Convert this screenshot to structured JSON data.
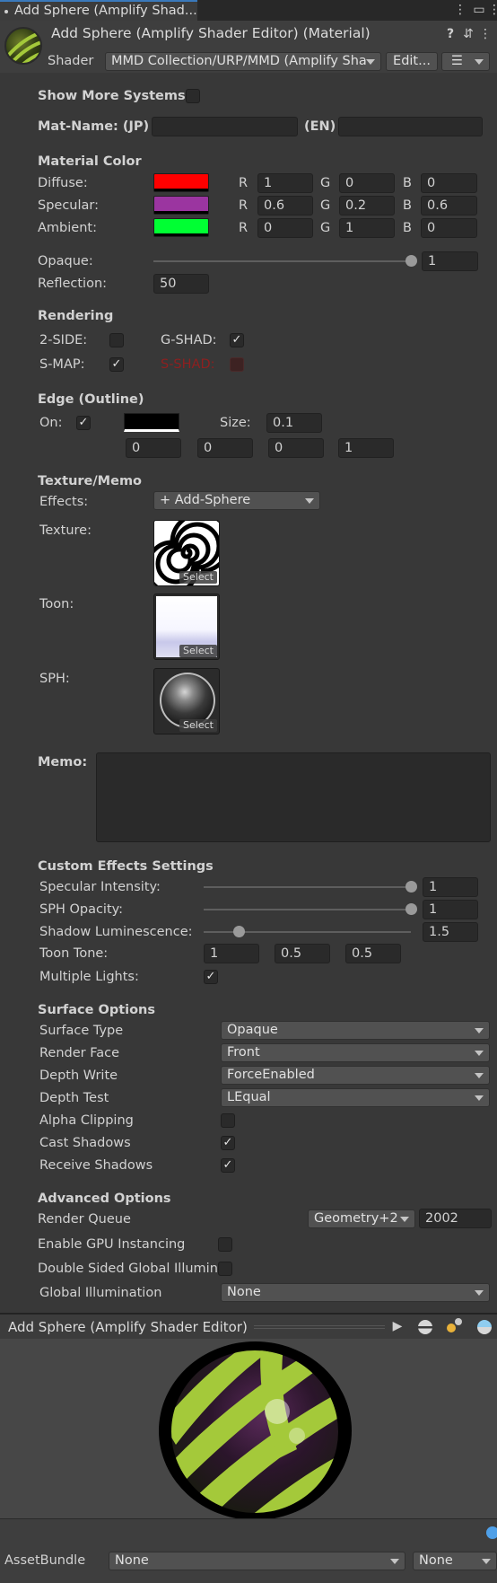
{
  "window": {
    "tab_title": "Add Sphere (Amplify Shad...",
    "header_title": "Add Sphere (Amplify Shader Editor) (Material)",
    "shader_label": "Shader",
    "shader_value": "MMD Collection/URP/MMD (Amplify Sha",
    "edit_button": "Edit..."
  },
  "mmd": {
    "show_more_systems": "Show More Systems:",
    "mat_name_jp": "Mat-Name: (JP)",
    "mat_name_en": "(EN)",
    "material_color_header": "Material Color",
    "diffuse_label": "Diffuse:",
    "specular_label": "Specular:",
    "ambient_label": "Ambient:",
    "r_label": "R",
    "g_label": "G",
    "b_label": "B",
    "diffuse": {
      "r": "1",
      "g": "0",
      "b": "0",
      "color": "#ff0000"
    },
    "specular": {
      "r": "0.6",
      "g": "0.2",
      "b": "0.6",
      "color": "#9b35a0"
    },
    "ambient": {
      "r": "0",
      "g": "1",
      "b": "0",
      "color": "#00ff33"
    },
    "opaque_label": "Opaque:",
    "opaque_value": "1",
    "opaque_level": 1,
    "reflection_label": "Reflection:",
    "reflection_value": "50",
    "rendering_header": "Rendering",
    "two_side_label": "2-SIDE:",
    "g_shad_label": "G-SHAD:",
    "s_map_label": "S-MAP:",
    "s_shad_label": "S-SHAD:",
    "edge_header": "Edge (Outline)",
    "edge_on_label": "On:",
    "edge_size_label": "Size:",
    "edge_size_value": "0.1",
    "edge_rgba": [
      "0",
      "0",
      "0",
      "1"
    ],
    "texture_header": "Texture/Memo",
    "effects_label": "Effects:",
    "effects_value": "+ Add-Sphere",
    "texture_label": "Texture:",
    "toon_label": "Toon:",
    "sph_label": "SPH:",
    "select_label": "Select",
    "memo_label": "Memo:"
  },
  "custom_effects": {
    "header": "Custom Effects Settings",
    "specular_intensity_label": "Specular Intensity:",
    "specular_intensity_value": "1",
    "specular_intensity_level": 1,
    "sph_opacity_label": "SPH Opacity:",
    "sph_opacity_value": "1",
    "sph_opacity_level": 1,
    "shadow_lum_label": "Shadow Luminescence:",
    "shadow_lum_value": "1.5",
    "shadow_lum_level": 0.17,
    "toon_tone_label": "Toon Tone:",
    "toon_tone_values": [
      "1",
      "0.5",
      "0.5"
    ],
    "multiple_lights_label": "Multiple Lights:"
  },
  "surface": {
    "header": "Surface Options",
    "surface_type_label": "Surface Type",
    "surface_type_value": "Opaque",
    "render_face_label": "Render Face",
    "render_face_value": "Front",
    "depth_write_label": "Depth Write",
    "depth_write_value": "ForceEnabled",
    "depth_test_label": "Depth Test",
    "depth_test_value": "LEqual",
    "alpha_clipping_label": "Alpha Clipping",
    "cast_shadows_label": "Cast Shadows",
    "receive_shadows_label": "Receive Shadows"
  },
  "advanced": {
    "header": "Advanced Options",
    "render_queue_label": "Render Queue",
    "render_queue_dropdown": "Geometry+2",
    "render_queue_value": "2002",
    "gpu_instancing_label": "Enable GPU Instancing",
    "double_sided_gi_label": "Double Sided Global Illumin",
    "global_illumination_label": "Global Illumination",
    "global_illumination_value": "None"
  },
  "preview": {
    "title": "Add Sphere (Amplify Shader Editor)"
  },
  "footer": {
    "assetbundle_label": "AssetBundle",
    "bundle_value": "None",
    "variant_value": "None"
  },
  "colors": {
    "background": "#383838",
    "field": "#2a2a2a",
    "tab_accent": "#3a79bb",
    "sphere_stripes": "#a4c93a"
  }
}
